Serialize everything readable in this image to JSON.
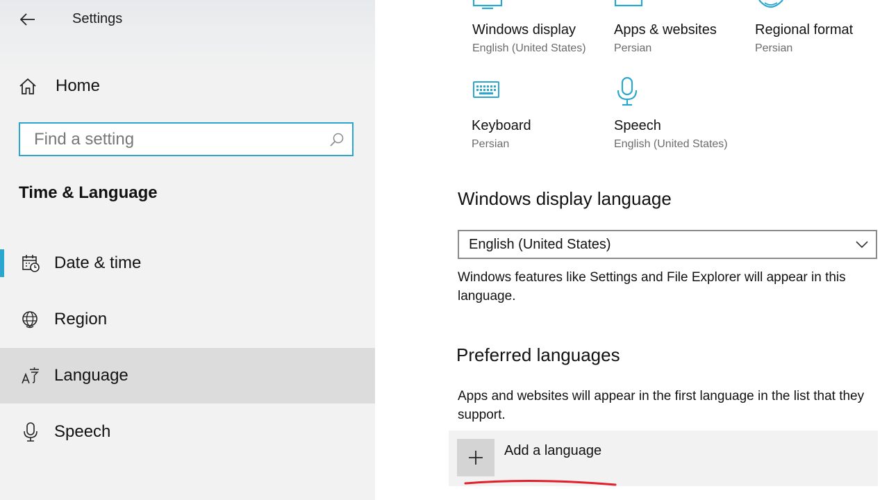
{
  "window": {
    "title": "Settings"
  },
  "sidebar": {
    "home_label": "Home",
    "search": {
      "placeholder": "Find a setting",
      "value": ""
    },
    "section_title": "Time & Language",
    "items": [
      {
        "label": "Date & time",
        "icon": "calendar-clock-icon"
      },
      {
        "label": "Region",
        "icon": "globe-icon"
      },
      {
        "label": "Language",
        "icon": "language-icon",
        "selected": true
      },
      {
        "label": "Speech",
        "icon": "microphone-icon"
      }
    ]
  },
  "main": {
    "tiles": [
      {
        "name": "Windows display",
        "sub": "English (United States)",
        "icon": "monitor-icon"
      },
      {
        "name": "Apps & websites",
        "sub": "Persian",
        "icon": "window-icon"
      },
      {
        "name": "Regional format",
        "sub": "Persian",
        "icon": "globe-icon"
      },
      {
        "name": "Keyboard",
        "sub": "Persian",
        "icon": "keyboard-icon"
      },
      {
        "name": "Speech",
        "sub": "English (United States)",
        "icon": "microphone-icon"
      }
    ],
    "display_language": {
      "heading": "Windows display language",
      "selected": "English (United States)",
      "description": "Windows features like Settings and File Explorer will appear in this language."
    },
    "preferred": {
      "heading": "Preferred languages",
      "description": "Apps and websites will appear in the first language in the list that they support.",
      "add_label": "Add a language"
    }
  },
  "colors": {
    "accent": "#2ba6cf",
    "sidebar_bg": "#f2f2f2",
    "selected_bg": "#dcdcdc",
    "annotation_red": "#e0202a"
  }
}
